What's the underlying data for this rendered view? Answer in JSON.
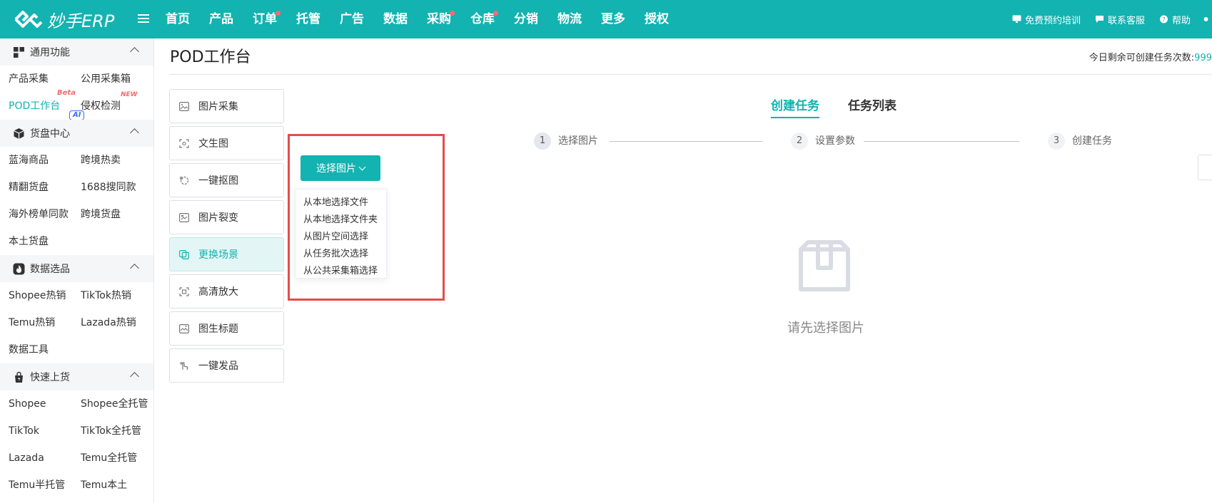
{
  "app": {
    "logo_text": "妙手ERP",
    "accent_color": "#12b3b0"
  },
  "nav": {
    "items": [
      {
        "label": "首页",
        "dot": false
      },
      {
        "label": "产品",
        "dot": false
      },
      {
        "label": "订单",
        "dot": true
      },
      {
        "label": "托管",
        "dot": false
      },
      {
        "label": "广告",
        "dot": false
      },
      {
        "label": "数据",
        "dot": false
      },
      {
        "label": "采购",
        "dot": true
      },
      {
        "label": "仓库",
        "dot": true
      },
      {
        "label": "分销",
        "dot": false
      },
      {
        "label": "物流",
        "dot": false
      },
      {
        "label": "更多",
        "dot": false
      },
      {
        "label": "授权",
        "dot": false
      }
    ],
    "right": {
      "training": "免费预约培训",
      "support": "联系客服",
      "help": "帮助"
    }
  },
  "sidebar": {
    "sections": [
      {
        "title": "通用功能",
        "icon": "grid-icon",
        "links": [
          "产品采集",
          "公用采集箱",
          "POD工作台",
          "侵权检测"
        ]
      },
      {
        "title": "货盘中心",
        "icon": "cube-icon",
        "links": [
          "蓝海商品",
          "跨境热卖",
          "精翻货盘",
          "1688搜同款",
          "海外榜单同款",
          "跨境货盘",
          "本土货盘"
        ]
      },
      {
        "title": "数据选品",
        "icon": "fire-icon",
        "links": [
          "Shopee热销",
          "TikTok热销",
          "Temu热销",
          "Lazada热销",
          "数据工具"
        ]
      },
      {
        "title": "快速上货",
        "icon": "bag-icon",
        "links": [
          "Shopee",
          "Shopee全托管",
          "TikTok",
          "TikTok全托管",
          "Lazada",
          "Temu全托管",
          "Temu半托管",
          "Temu本土"
        ]
      }
    ],
    "tags": {
      "beta": "Beta",
      "new": "NEW",
      "ai": "AI"
    }
  },
  "main": {
    "title": "POD工作台",
    "quota_label": "今日剩余可创建任务次数:",
    "quota_value": "999",
    "tools": [
      {
        "label": "图片采集",
        "icon": "image-icon"
      },
      {
        "label": "文生图",
        "icon": "text-to-image-icon"
      },
      {
        "label": "一键抠图",
        "icon": "cutout-icon"
      },
      {
        "label": "图片裂变",
        "icon": "image-variation-icon"
      },
      {
        "label": "更换场景",
        "icon": "scene-icon",
        "active": true
      },
      {
        "label": "高清放大",
        "icon": "upscale-icon"
      },
      {
        "label": "图生标题",
        "icon": "image-title-icon"
      },
      {
        "label": "一键发品",
        "icon": "publish-icon"
      }
    ],
    "select_button": "选择图片",
    "dropdown": [
      "从本地选择文件",
      "从本地选择文件夹",
      "从图片空间选择",
      "从任务批次选择",
      "从公共采集箱选择"
    ],
    "tabs": [
      "创建任务",
      "任务列表"
    ],
    "steps": [
      {
        "num": "1",
        "label": "选择图片"
      },
      {
        "num": "2",
        "label": "设置参数"
      },
      {
        "num": "3",
        "label": "创建任务"
      }
    ],
    "empty_text": "请先选择图片"
  }
}
